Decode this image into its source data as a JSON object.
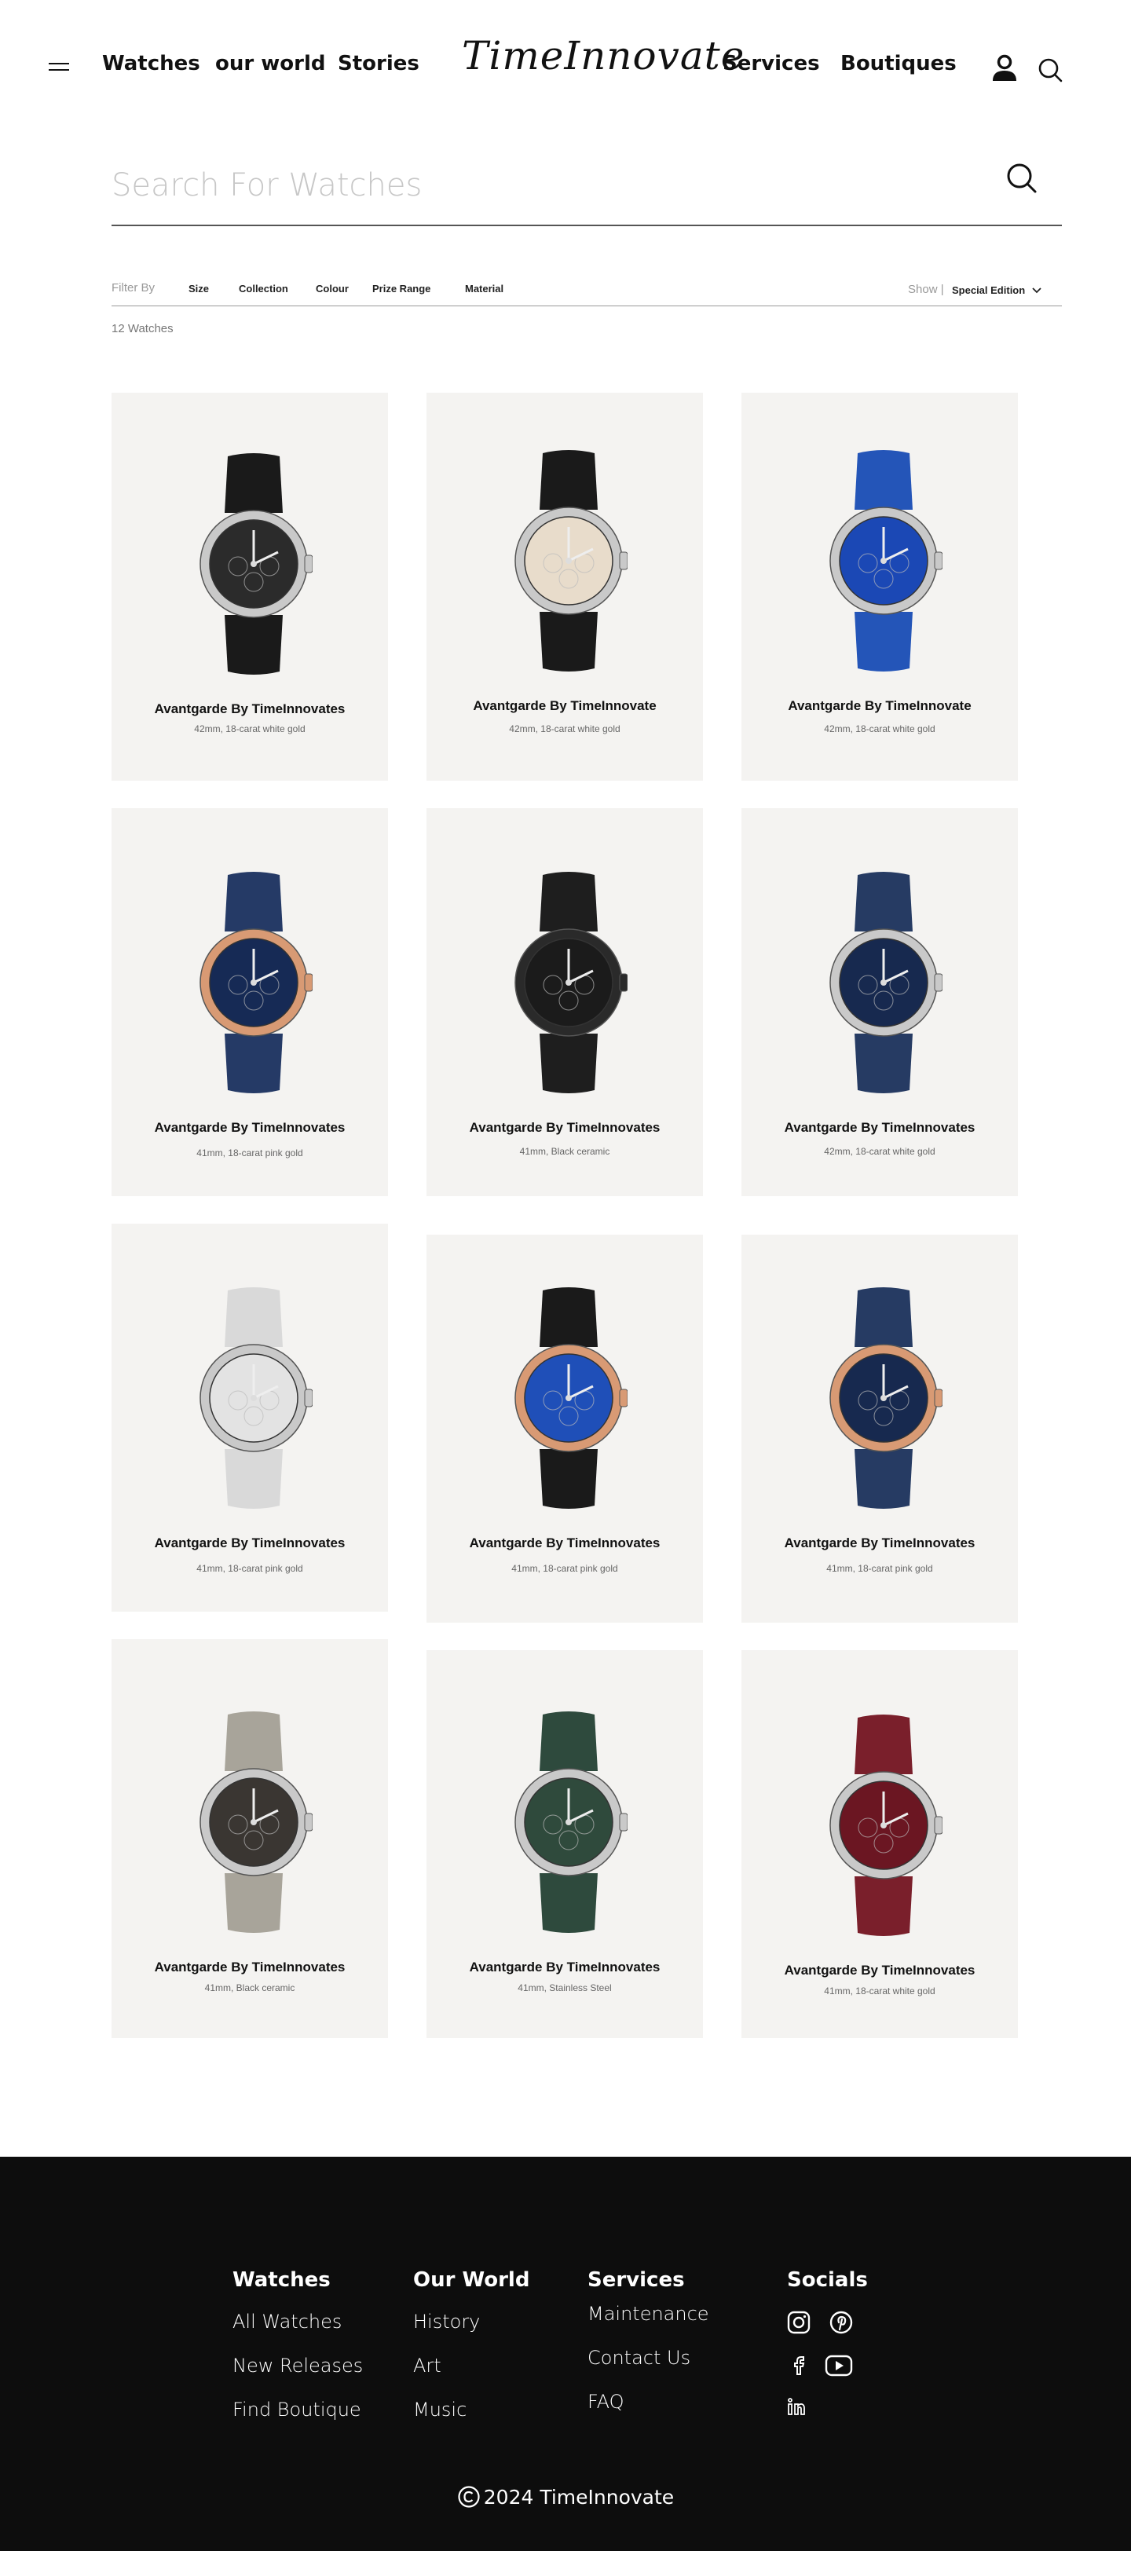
{
  "header": {
    "logo": "TimeInnovate",
    "nav_left": [
      "Watches",
      "our world",
      "Stories"
    ],
    "nav_right": [
      "Services",
      "Boutiques"
    ]
  },
  "search": {
    "placeholder": "Search For Watches",
    "value": ""
  },
  "filters": {
    "label": "Filter By",
    "options": [
      "Size",
      "Collection",
      "Colour",
      "Prize Range",
      "Material"
    ],
    "show_label": "Show |",
    "show_value": "Special Edition"
  },
  "results_count": "12 Watches",
  "products": [
    {
      "name": "Avantgarde By TimeInnovates",
      "desc": "42mm, 18-carat white gold",
      "dial": "#2b2b2b",
      "strap": "#1a1a1a",
      "case": "#c9c9c9"
    },
    {
      "name": "Avantgarde By TimeInnovate",
      "desc": "42mm, 18-carat white gold",
      "dial": "#e8dccb",
      "strap": "#1a1a1a",
      "case": "#c9c9c9"
    },
    {
      "name": "Avantgarde By TimeInnovate",
      "desc": "42mm, 18-carat white gold",
      "dial": "#1b48b5",
      "strap": "#2455b8",
      "case": "#c9c9c9"
    },
    {
      "name": "Avantgarde By TimeInnovates",
      "desc": "41mm, 18-carat pink gold",
      "dial": "#162a55",
      "strap": "#253a66",
      "case": "#d89a74"
    },
    {
      "name": "Avantgarde By TimeInnovates",
      "desc": "41mm, Black ceramic",
      "dial": "#1b1b1b",
      "strap": "#1e1e1e",
      "case": "#2a2a2a"
    },
    {
      "name": "Avantgarde By TimeInnovates",
      "desc": "42mm, 18-carat white gold",
      "dial": "#17294f",
      "strap": "#263b63",
      "case": "#c9c9c9"
    },
    {
      "name": "Avantgarde By TimeInnovates",
      "desc": "41mm, 18-carat pink gold",
      "dial": "#e3e3e3",
      "strap": "#d9d9d9",
      "case": "#c9c9c9"
    },
    {
      "name": "Avantgarde By TimeInnovates",
      "desc": "41mm, 18-carat pink gold",
      "dial": "#1f4fb8",
      "strap": "#1a1a1a",
      "case": "#d89a74"
    },
    {
      "name": "Avantgarde By TimeInnovates",
      "desc": "41mm, 18-carat pink gold",
      "dial": "#17294f",
      "strap": "#263b63",
      "case": "#d89a74"
    },
    {
      "name": "Avantgarde By TimeInnovates",
      "desc": "41mm, Black ceramic",
      "dial": "#3a3632",
      "strap": "#a8a49a",
      "case": "#c9c9c9"
    },
    {
      "name": "Avantgarde By TimeInnovates",
      "desc": "41mm, Stainless Steel",
      "dial": "#2f4a3c",
      "strap": "#2e4a3d",
      "case": "#c9c9c9"
    },
    {
      "name": "Avantgarde By TimeInnovates",
      "desc": "41mm, 18-carat white gold",
      "dial": "#6b1622",
      "strap": "#7a1f2b",
      "case": "#c9c9c9"
    }
  ],
  "footer": {
    "columns": [
      {
        "title": "Watches",
        "links": [
          "All Watches",
          "New Releases",
          "Find Boutique"
        ]
      },
      {
        "title": "Our World",
        "links": [
          "History",
          "Art",
          "Music"
        ]
      },
      {
        "title": "Services",
        "links": [
          "Maintenance",
          "Contact Us",
          "FAQ"
        ]
      }
    ],
    "socials_title": "Socials",
    "socials": [
      "instagram-icon",
      "pinterest-icon",
      "facebook-icon",
      "youtube-icon",
      "linkedin-icon"
    ],
    "copyright": "2024 TimeInnovate"
  }
}
